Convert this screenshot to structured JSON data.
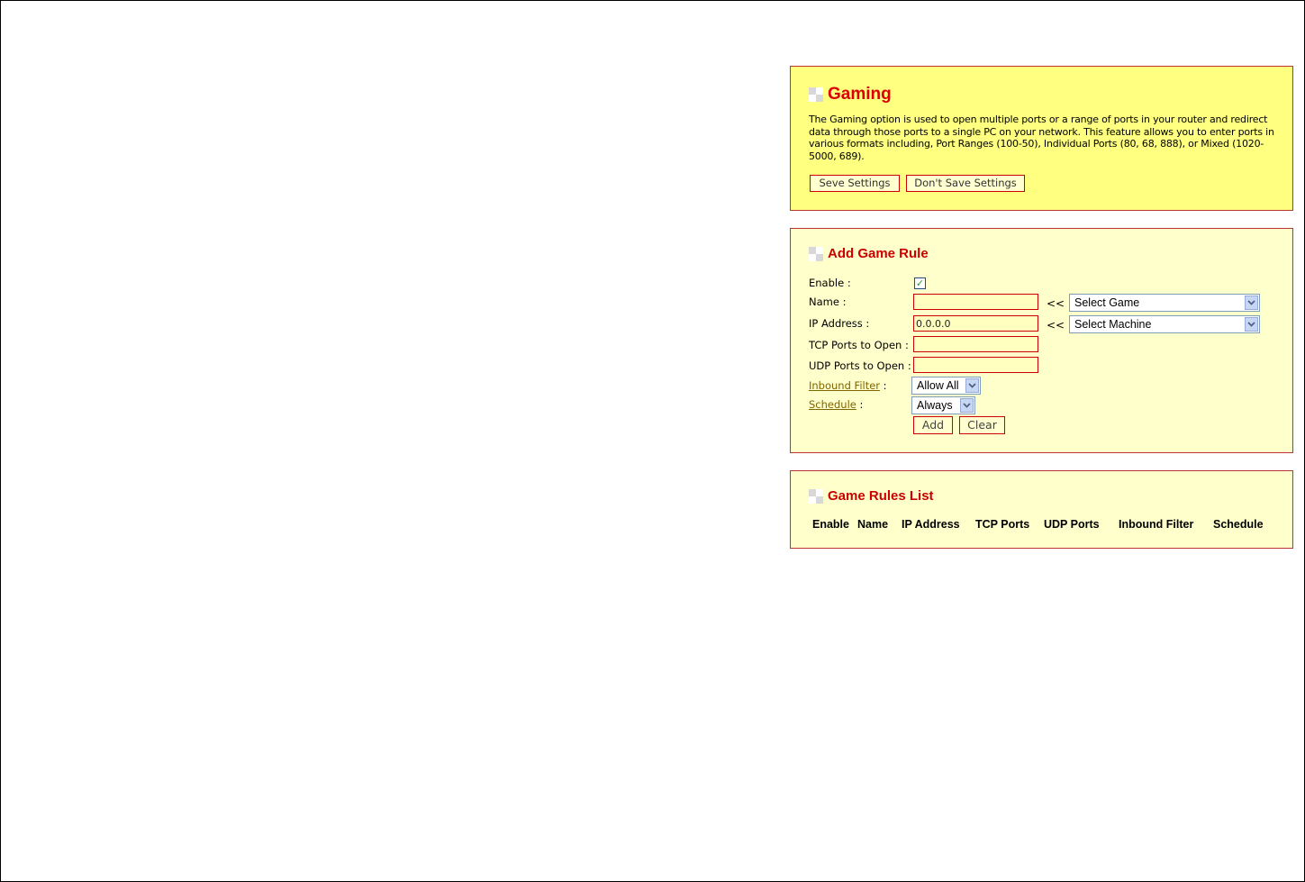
{
  "gaming": {
    "title": "Gaming",
    "description": "The Gaming option is used to open multiple ports or a range of ports in your router and redirect data through those ports to a single PC on your network. This feature allows you to enter ports in various formats including, Port Ranges (100-50), Individual Ports (80, 68, 888), or Mixed (1020-5000, 689).",
    "save_label": "Seve Settings",
    "dont_save_label": "Don't Save Settings"
  },
  "add_rule": {
    "title": "Add Game Rule",
    "enable_label": "Enable :",
    "enable_checked": true,
    "name_label": "Name :",
    "name_value": "",
    "ip_label": "IP Address :",
    "ip_value": "0.0.0.0",
    "tcp_label": "TCP Ports to Open :",
    "tcp_value": "",
    "udp_label": "UDP Ports to Open :",
    "udp_value": "",
    "inbound_label": "Inbound Filter",
    "inbound_suffix": " :",
    "schedule_label": "Schedule",
    "schedule_suffix": " :",
    "arrow_text": "<<",
    "select_game": "Select Game",
    "select_machine": "Select Machine",
    "inbound_value": "Allow All",
    "schedule_value": "Always",
    "add_label": "Add",
    "clear_label": "Clear"
  },
  "rules_list": {
    "title": "Game Rules List",
    "columns": [
      "Enable",
      "Name",
      "IP Address",
      "TCP Ports",
      "UDP Ports",
      "Inbound Filter",
      "Schedule"
    ]
  },
  "icons": {
    "section_icon": "grid-square-icon",
    "dropdown_icon": "chevron-down-icon",
    "checkbox_icon": "checkmark-icon"
  },
  "colors": {
    "gaming_panel_bg": "#ffff80",
    "panel_bg": "#ffffcc",
    "border": "#bb3333",
    "title_red": "#dd0000",
    "link": "#806600"
  }
}
